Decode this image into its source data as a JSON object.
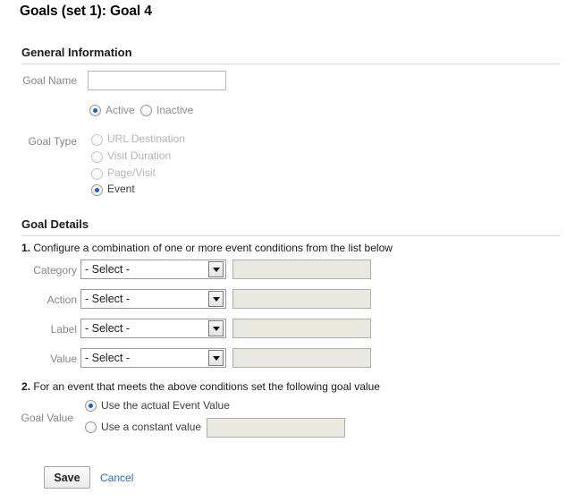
{
  "page": {
    "title": "Goals (set 1): Goal 4"
  },
  "general": {
    "heading": "General Information",
    "goal_name": {
      "label": "Goal Name",
      "value": "",
      "placeholder": ""
    },
    "status": {
      "options": [
        {
          "label": "Active",
          "selected": true,
          "disabled": false
        },
        {
          "label": "Inactive",
          "selected": false,
          "disabled": false
        }
      ]
    },
    "goal_type": {
      "label": "Goal Type",
      "options": [
        {
          "label": "URL Destination",
          "selected": false,
          "disabled": true
        },
        {
          "label": "Visit Duration",
          "selected": false,
          "disabled": true
        },
        {
          "label": "Page/Visit",
          "selected": false,
          "disabled": true
        },
        {
          "label": "Event",
          "selected": true,
          "disabled": false
        }
      ]
    }
  },
  "details": {
    "heading": "Goal Details",
    "step1_text": "Configure a combination of one or more event conditions from the list below",
    "step1_num": "1.",
    "conditions": [
      {
        "label": "Category",
        "select_value": "- Select -",
        "input_value": "",
        "input_disabled": true
      },
      {
        "label": "Action",
        "select_value": "- Select -",
        "input_value": "",
        "input_disabled": true
      },
      {
        "label": "Label",
        "select_value": "- Select -",
        "input_value": "",
        "input_disabled": true
      },
      {
        "label": "Value",
        "select_value": "- Select -",
        "input_value": "",
        "input_disabled": true
      }
    ],
    "step2_num": "2.",
    "step2_text": "For an event that meets the above conditions set the following goal value",
    "goal_value": {
      "label": "Goal Value",
      "options": [
        {
          "label": "Use the actual Event Value",
          "selected": true
        },
        {
          "label": "Use a constant value",
          "selected": false
        }
      ],
      "constant_value": "",
      "constant_disabled": true
    }
  },
  "actions": {
    "save_label": "Save",
    "cancel_label": "Cancel"
  },
  "colors": {
    "accent": "#1763c4",
    "link": "#2a6ebb",
    "label": "#878787",
    "disabled_bg": "#e9e9e1"
  }
}
